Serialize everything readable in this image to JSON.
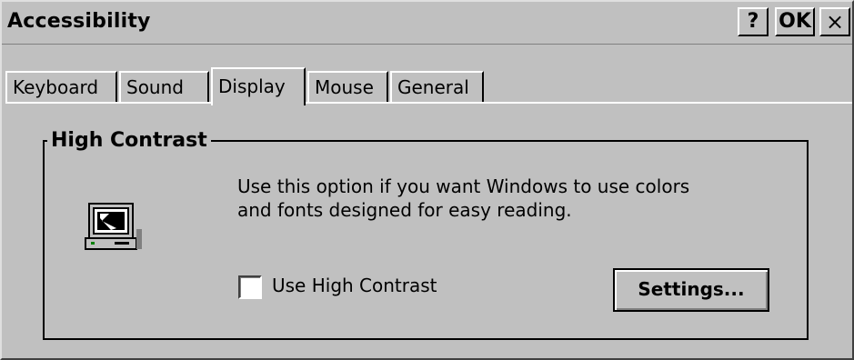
{
  "window": {
    "title": "Accessibility",
    "help_label": "?",
    "ok_label": "OK",
    "close_label": "×"
  },
  "tabs": [
    {
      "label": "Keyboard",
      "active": false
    },
    {
      "label": "Sound",
      "active": false
    },
    {
      "label": "Display",
      "active": true
    },
    {
      "label": "Mouse",
      "active": false
    },
    {
      "label": "General",
      "active": false
    }
  ],
  "high_contrast": {
    "group_title": "High Contrast",
    "description_line1": "Use this option if you want Windows to use colors",
    "description_line2": "and fonts designed for easy reading.",
    "checkbox_label": "Use High Contrast",
    "checkbox_checked": false,
    "settings_button": "Settings...",
    "icon": "monitor-icon"
  }
}
